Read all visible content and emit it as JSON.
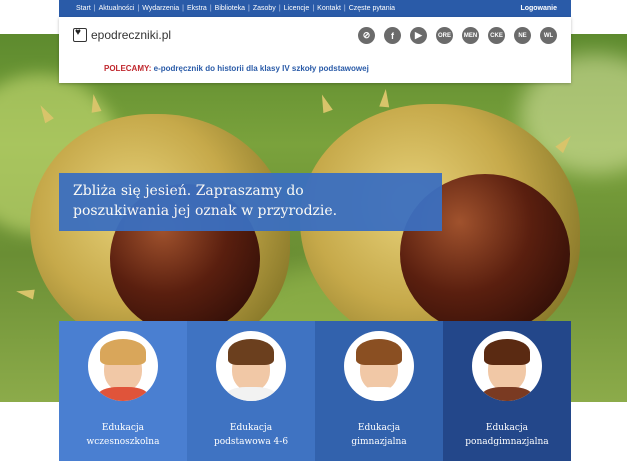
{
  "nav": {
    "items": [
      "Start",
      "Aktualności",
      "Wydarzenia",
      "Ekstra",
      "Biblioteka",
      "Zasoby",
      "Licencje",
      "Kontakt",
      "Częste pytania"
    ],
    "login": "Logowanie"
  },
  "header": {
    "logo_text": "epodreczniki.pl",
    "icons": [
      {
        "name": "share-icon",
        "label": "⊘"
      },
      {
        "name": "facebook-icon",
        "label": "f"
      },
      {
        "name": "youtube-icon",
        "label": "▶"
      },
      {
        "name": "ore-icon",
        "label": "ORE"
      },
      {
        "name": "men-icon",
        "label": "MEN"
      },
      {
        "name": "cke-icon",
        "label": "CKE"
      },
      {
        "name": "ne-icon",
        "label": "NE"
      },
      {
        "name": "wl-icon",
        "label": "WL"
      }
    ],
    "recommend_label": "POLECAMY:",
    "recommend_link": "e-podręcznik do historii dla klasy IV szkoły podstawowej"
  },
  "hero": {
    "line1": "Zbliża się jesień. Zapraszamy do",
    "line2": "poszukiwania jej oznak w przyrodzie."
  },
  "tiles": [
    {
      "line1": "Edukacja",
      "line2": "wczesnoszkolna"
    },
    {
      "line1": "Edukacja",
      "line2": "podstawowa 4-6"
    },
    {
      "line1": "Edukacja",
      "line2": "gimnazjalna"
    },
    {
      "line1": "Edukacja",
      "line2": "ponadgimnazjalna"
    }
  ],
  "colors": {
    "brand_blue": "#2a5ba8",
    "recommend_red": "#c0272d"
  }
}
